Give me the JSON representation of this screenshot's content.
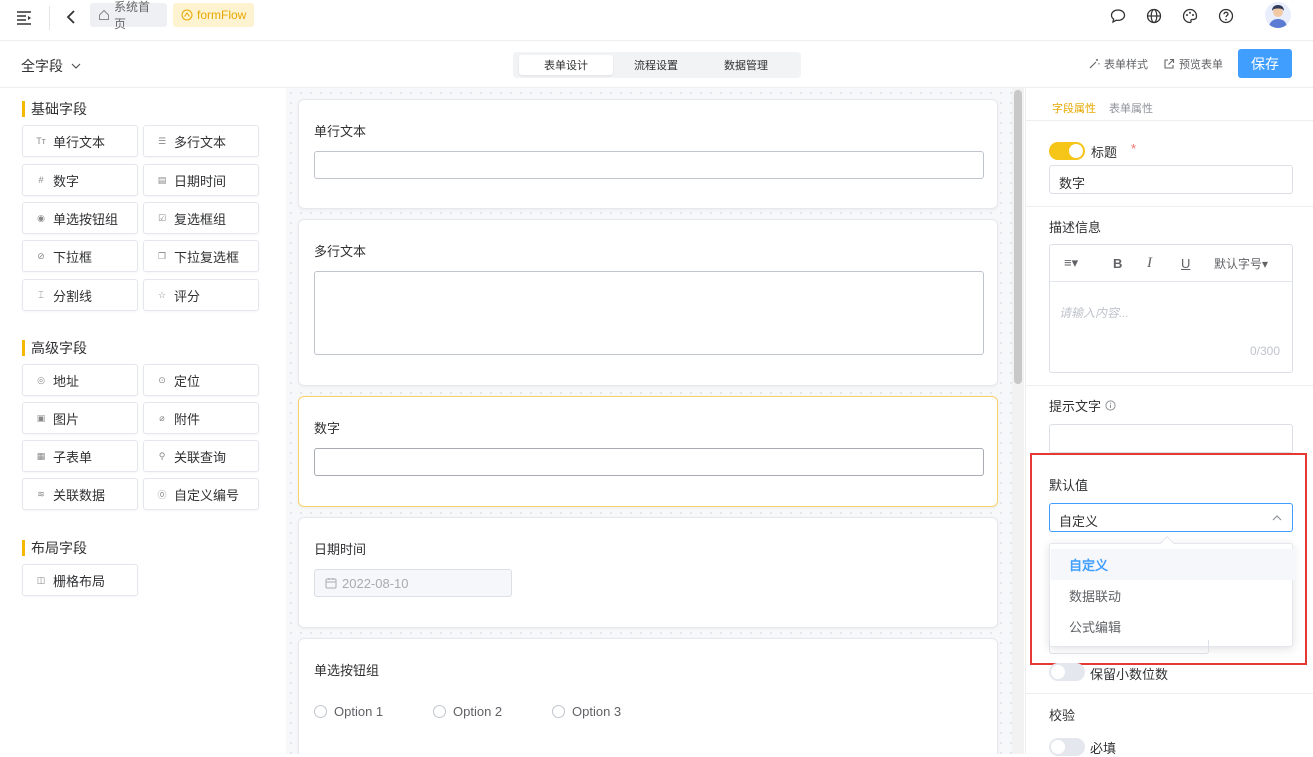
{
  "topbar": {
    "crumbs": [
      "系统首页",
      "formFlow"
    ],
    "icons": [
      "menu-toggle-icon",
      "back-arrow-icon",
      "home-icon",
      "flow-icon",
      "chat-icon",
      "globe-icon",
      "palette-icon",
      "help-icon",
      "avatar"
    ]
  },
  "toolbar": {
    "field_scope": "全字段",
    "tabs": [
      "表单设计",
      "流程设置",
      "数据管理"
    ],
    "active_tab": "表单设计",
    "form_style": "表单样式",
    "preview": "预览表单",
    "save": "保存",
    "accent_color": "#f5b800",
    "primary_color": "#409eff"
  },
  "palette": {
    "groups": [
      {
        "title": "基础字段",
        "items": [
          {
            "label": "单行文本",
            "icon": "text-icon"
          },
          {
            "label": "多行文本",
            "icon": "textarea-icon"
          },
          {
            "label": "数字",
            "icon": "hash-icon"
          },
          {
            "label": "日期时间",
            "icon": "calendar-icon"
          },
          {
            "label": "单选按钮组",
            "icon": "radio-icon"
          },
          {
            "label": "复选框组",
            "icon": "checkbox-icon"
          },
          {
            "label": "下拉框",
            "icon": "select-icon"
          },
          {
            "label": "下拉复选框",
            "icon": "multi-select-icon"
          },
          {
            "label": "分割线",
            "icon": "divider-icon"
          },
          {
            "label": "评分",
            "icon": "star-icon"
          }
        ]
      },
      {
        "title": "高级字段",
        "items": [
          {
            "label": "地址",
            "icon": "compass-icon"
          },
          {
            "label": "定位",
            "icon": "location-icon"
          },
          {
            "label": "图片",
            "icon": "image-icon"
          },
          {
            "label": "附件",
            "icon": "paperclip-icon"
          },
          {
            "label": "子表单",
            "icon": "table-icon"
          },
          {
            "label": "关联查询",
            "icon": "search-icon"
          },
          {
            "label": "关联数据",
            "icon": "database-icon"
          },
          {
            "label": "自定义编号",
            "icon": "number-icon"
          }
        ]
      },
      {
        "title": "布局字段",
        "items": [
          {
            "label": "栅格布局",
            "icon": "grid-icon"
          }
        ]
      }
    ]
  },
  "canvas": {
    "cards": [
      {
        "label": "单行文本",
        "type": "input"
      },
      {
        "label": "多行文本",
        "type": "textarea"
      },
      {
        "label": "数字",
        "type": "input",
        "selected": true
      },
      {
        "label": "日期时间",
        "type": "date",
        "value": "2022-08-10"
      },
      {
        "label": "单选按钮组",
        "type": "radio",
        "options": [
          "Option 1",
          "Option 2",
          "Option 3"
        ]
      }
    ]
  },
  "props": {
    "tabs": [
      "字段属性",
      "表单属性"
    ],
    "active_tab": "字段属性",
    "title_label": "标题",
    "required_mark": "*",
    "title_value": "数字",
    "desc_label": "描述信息",
    "editor_font": "默认字号",
    "editor_placeholder": "请输入内容...",
    "editor_count": "0/300",
    "hint_label": "提示文字",
    "default_label": "默认值",
    "default_value": "自定义",
    "dropdown_options": [
      "自定义",
      "数据联动",
      "公式编辑"
    ],
    "decimal_label": "保留小数位数",
    "validate_label": "校验",
    "required_label": "必填",
    "highlight_color": "#e53935"
  }
}
